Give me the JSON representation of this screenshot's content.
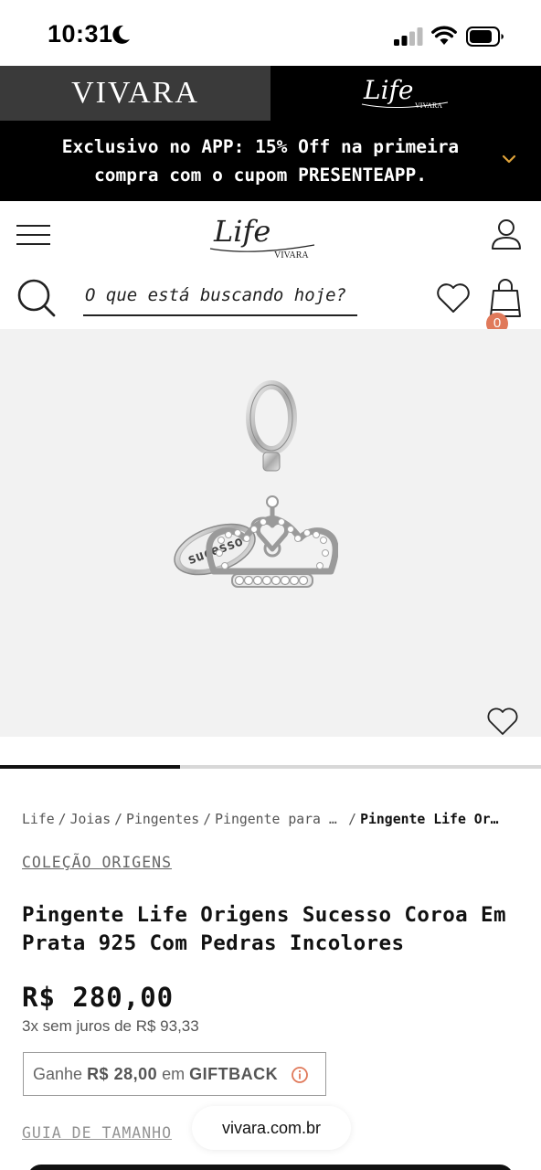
{
  "status_bar": {
    "time": "10:31"
  },
  "brand_tabs": {
    "vivara": "VIVARA",
    "life": "Life",
    "life_sub": "VIVARA"
  },
  "promo": {
    "line1": "Exclusivo no APP: 15% Off na primeira",
    "line2": "compra com o cupom PRESENTEAPP."
  },
  "header": {
    "logo": "Life",
    "logo_sub": "VIVARA",
    "search_placeholder": "O que está buscando hoje?",
    "cart_count": "0"
  },
  "product": {
    "engraving": "sucesso",
    "gallery_progress": 0.333,
    "breadcrumb": [
      {
        "label": "Life"
      },
      {
        "label": "Joias"
      },
      {
        "label": "Pingentes"
      },
      {
        "label": "Pingente para P…"
      }
    ],
    "breadcrumb_current": "Pingente Life Ori…",
    "collection": "COLEÇÃO ORIGENS",
    "title": "Pingente Life Origens Sucesso Coroa Em Prata 925 Com Pedras Incolores",
    "price": "R$ 280,00",
    "installments": "3x sem juros de R$ 93,33",
    "giftback": {
      "prefix": "Ganhe",
      "amount": "R$ 28,00",
      "middle": "em",
      "label": "GIFTBACK"
    },
    "size_guide": "GUIA DE TAMANHO"
  },
  "browser": {
    "url": "vivara.com.br"
  },
  "colors": {
    "badge": "#e0795a",
    "black": "#000000",
    "tab_gray": "#3a3a3a",
    "gallery_bg": "#f2f2f2"
  }
}
